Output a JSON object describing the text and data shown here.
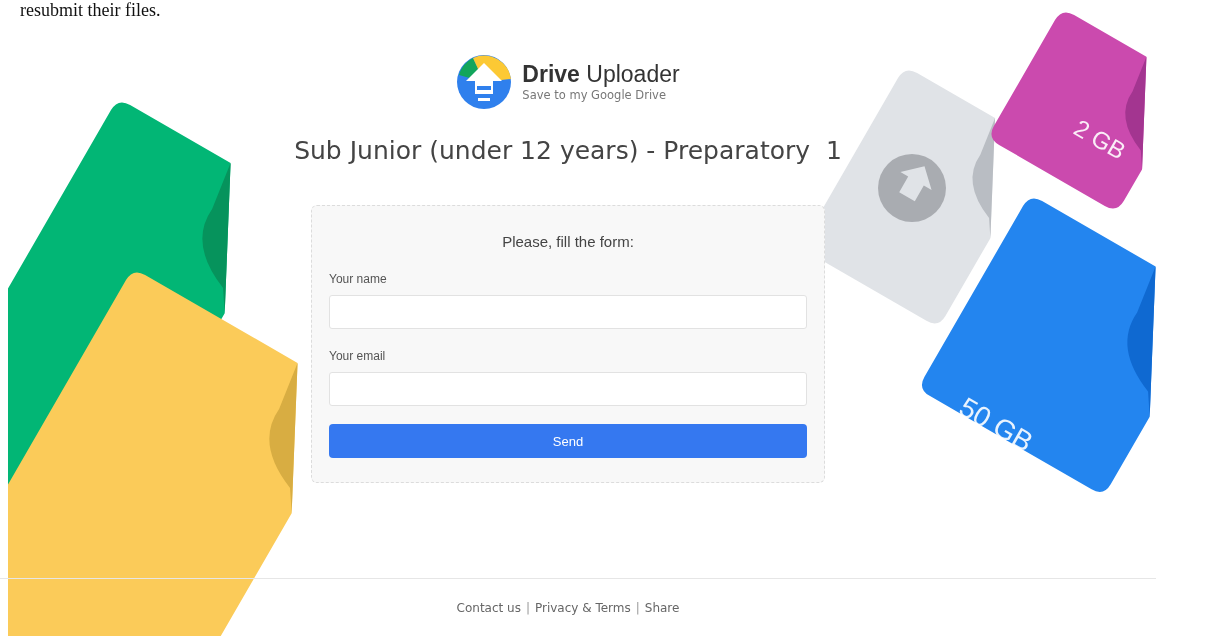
{
  "top_text": "resubmit their files.",
  "header": {
    "brand": "**Drive** Uploader",
    "tagline": "Save to my Google Drive"
  },
  "title": "Sub Junior (under 12 years) - Preparatory  1",
  "form": {
    "heading": "Please, fill the form:",
    "fields": [
      {
        "label": "Your name"
      },
      {
        "label": "Your email"
      }
    ],
    "submit": "Send"
  },
  "file_labels": [
    {
      "text": "2 GB"
    },
    {
      "text": "50 GB"
    }
  ],
  "footer": [
    {
      "kind": "link",
      "text": "Contact us"
    },
    {
      "kind": "separator",
      "text": "|"
    },
    {
      "kind": "link",
      "text": "Privacy & Terms"
    },
    {
      "kind": "separator",
      "text": "|"
    },
    {
      "kind": "link",
      "text": "Share"
    }
  ]
}
